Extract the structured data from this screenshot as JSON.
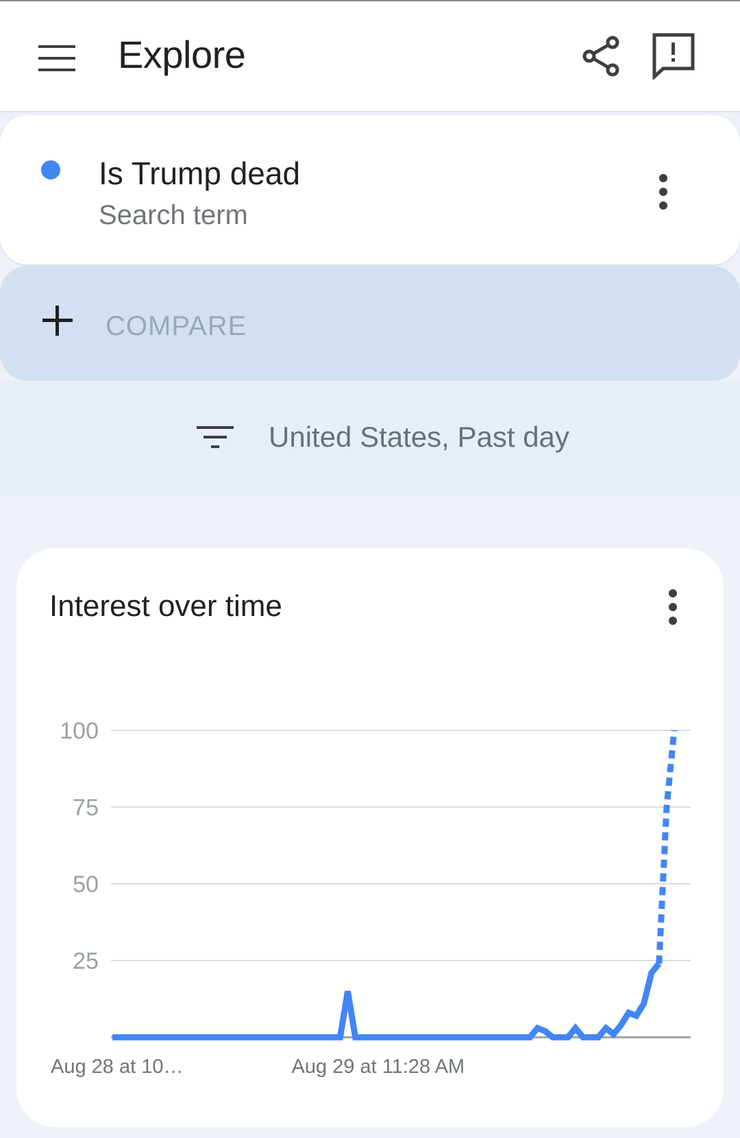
{
  "header": {
    "title": "Explore",
    "menu_icon": "menu-icon",
    "share_icon": "share-icon",
    "feedback_icon": "feedback-icon"
  },
  "search_term": {
    "name": "Is Trump dead",
    "type": "Search term",
    "color": "#4285f4",
    "menu_icon": "more-vert-icon"
  },
  "compare": {
    "label": "COMPARE",
    "icon": "add-icon"
  },
  "filter": {
    "label": "United States, Past day",
    "icon": "filter-icon"
  },
  "interest_card": {
    "title": "Interest over time",
    "menu_icon": "more-vert-icon"
  },
  "chart_data": {
    "type": "line",
    "title": "Interest over time",
    "xlabel": "",
    "ylabel": "",
    "ylim": [
      0,
      100
    ],
    "yticks": [
      100,
      75,
      50,
      25
    ],
    "xtick_labels": [
      "Aug 28 at 10…",
      "Aug 29 at 11:28 AM"
    ],
    "xtick_positions": [
      0,
      31
    ],
    "grid": true,
    "line_color": "#4285f4",
    "partial_from_index": 72,
    "series": [
      {
        "values": [
          0,
          0,
          0,
          0,
          0,
          0,
          0,
          0,
          0,
          0,
          0,
          0,
          0,
          0,
          0,
          0,
          0,
          0,
          0,
          0,
          0,
          0,
          0,
          0,
          0,
          0,
          0,
          0,
          0,
          0,
          0,
          15,
          0,
          0,
          0,
          0,
          0,
          0,
          0,
          0,
          0,
          0,
          0,
          0,
          0,
          0,
          0,
          0,
          0,
          0,
          0,
          0,
          0,
          0,
          0,
          0,
          3,
          2,
          0,
          0,
          0,
          3,
          0,
          0,
          0,
          3,
          1,
          4,
          8,
          7,
          11,
          21,
          24,
          75,
          100
        ]
      }
    ]
  }
}
